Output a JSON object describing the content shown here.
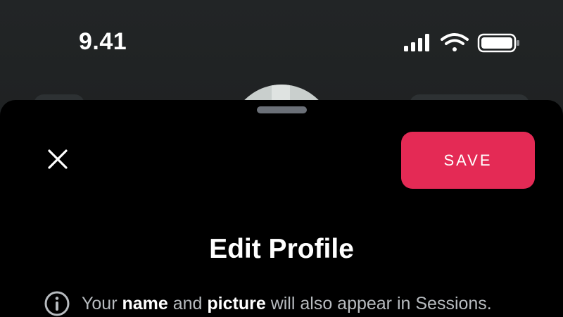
{
  "status_bar": {
    "time": "9.41",
    "icons": [
      "cellular-signal-icon",
      "wifi-icon",
      "battery-icon"
    ]
  },
  "sheet": {
    "close_icon": "close-icon",
    "save_label": "SAVE",
    "title": "Edit Profile",
    "notice": {
      "icon": "info-icon",
      "prefix": "Your ",
      "bold_1": "name",
      "middle": " and ",
      "bold_2": "picture",
      "suffix": " will also appear in Sessions."
    }
  },
  "colors": {
    "accent": "#e42a55",
    "sheet_background": "#000000",
    "notice_text": "#b7bbbf"
  }
}
